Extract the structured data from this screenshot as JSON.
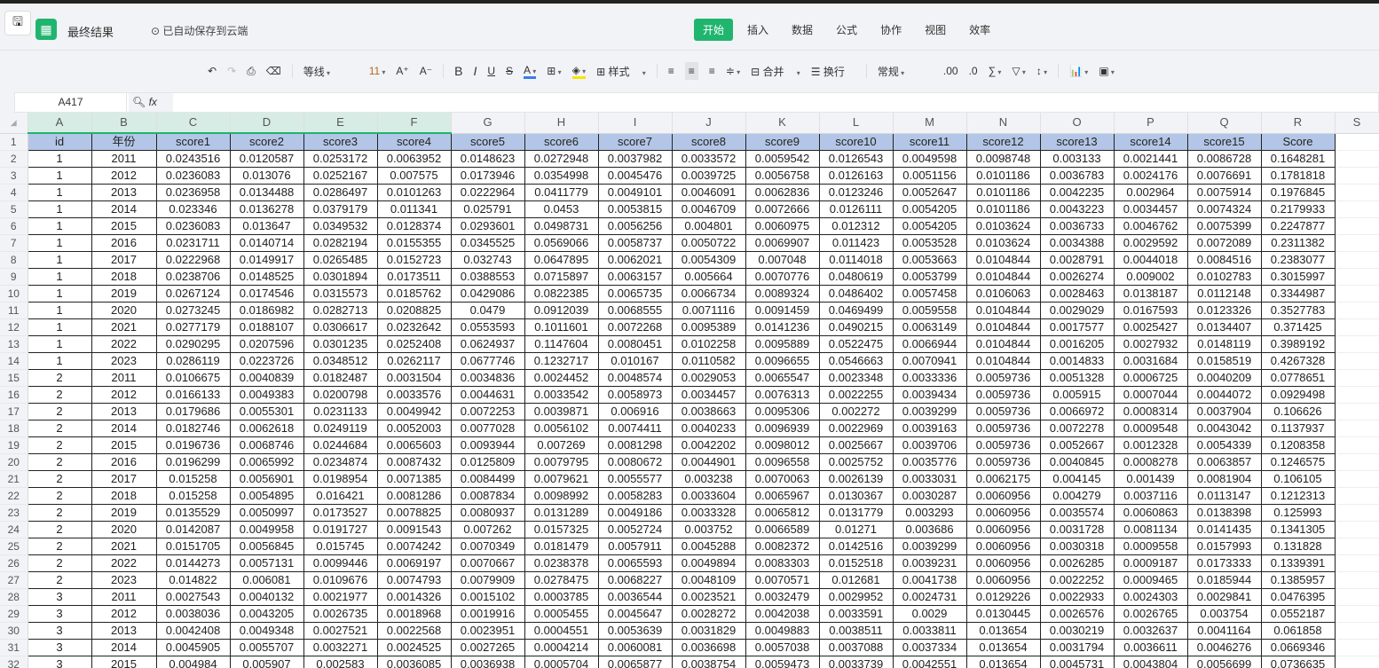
{
  "app": {
    "title": "最终结果",
    "save_status": "已自动保存到云端"
  },
  "menu": [
    "开始",
    "插入",
    "数据",
    "公式",
    "协作",
    "视图",
    "效率"
  ],
  "toolbar": {
    "font": "等线",
    "size": "11",
    "style": "样式",
    "merge": "合并",
    "wrap": "换行",
    "format": "常规"
  },
  "formula_bar": {
    "cell_ref": "A417",
    "fx": "fx",
    "value": ""
  },
  "columns": [
    "A",
    "B",
    "C",
    "D",
    "E",
    "F",
    "G",
    "H",
    "I",
    "J",
    "K",
    "L",
    "M",
    "N",
    "O",
    "P",
    "Q",
    "R",
    "S"
  ],
  "rows": [
    [
      "id",
      "年份",
      "score1",
      "score2",
      "score3",
      "score4",
      "score5",
      "score6",
      "score7",
      "score8",
      "score9",
      "score10",
      "score11",
      "score12",
      "score13",
      "score14",
      "score15",
      "Score"
    ],
    [
      "1",
      "2011",
      "0.0243516",
      "0.0120587",
      "0.0253172",
      "0.0063952",
      "0.0148623",
      "0.0272948",
      "0.0037982",
      "0.0033572",
      "0.0059542",
      "0.0126543",
      "0.0049598",
      "0.0098748",
      "0.003133",
      "0.0021441",
      "0.0086728",
      "0.1648281"
    ],
    [
      "1",
      "2012",
      "0.0236083",
      "0.013076",
      "0.0252167",
      "0.007575",
      "0.0173946",
      "0.0354998",
      "0.0045476",
      "0.0039725",
      "0.0056758",
      "0.0126163",
      "0.0051156",
      "0.0101186",
      "0.0036783",
      "0.0024176",
      "0.0076691",
      "0.1781818"
    ],
    [
      "1",
      "2013",
      "0.0236958",
      "0.0134488",
      "0.0286497",
      "0.0101263",
      "0.0222964",
      "0.0411779",
      "0.0049101",
      "0.0046091",
      "0.0062836",
      "0.0123246",
      "0.0052647",
      "0.0101186",
      "0.0042235",
      "0.002964",
      "0.0075914",
      "0.1976845"
    ],
    [
      "1",
      "2014",
      "0.023346",
      "0.0136278",
      "0.0379179",
      "0.011341",
      "0.025791",
      "0.0453",
      "0.0053815",
      "0.0046709",
      "0.0072666",
      "0.0126111",
      "0.0054205",
      "0.0101186",
      "0.0043223",
      "0.0034457",
      "0.0074324",
      "0.2179933"
    ],
    [
      "1",
      "2015",
      "0.0236083",
      "0.013647",
      "0.0349532",
      "0.0128374",
      "0.0293601",
      "0.0498731",
      "0.0056256",
      "0.004801",
      "0.0060975",
      "0.012312",
      "0.0054205",
      "0.0103624",
      "0.0036733",
      "0.0046762",
      "0.0075399",
      "0.2247877"
    ],
    [
      "1",
      "2016",
      "0.0231711",
      "0.0140714",
      "0.0282194",
      "0.0155355",
      "0.0345525",
      "0.0569066",
      "0.0058737",
      "0.0050722",
      "0.0069907",
      "0.011423",
      "0.0053528",
      "0.0103624",
      "0.0034388",
      "0.0029592",
      "0.0072089",
      "0.2311382"
    ],
    [
      "1",
      "2017",
      "0.0222968",
      "0.0149917",
      "0.0265485",
      "0.0152723",
      "0.032743",
      "0.0647895",
      "0.0062021",
      "0.0054309",
      "0.007048",
      "0.0114018",
      "0.0053663",
      "0.0104844",
      "0.0028791",
      "0.0044018",
      "0.0084516",
      "0.2383077"
    ],
    [
      "1",
      "2018",
      "0.0238706",
      "0.0148525",
      "0.0301894",
      "0.0173511",
      "0.0388553",
      "0.0715897",
      "0.0063157",
      "0.005664",
      "0.0070776",
      "0.0480619",
      "0.0053799",
      "0.0104844",
      "0.0026274",
      "0.009002",
      "0.0102783",
      "0.3015997"
    ],
    [
      "1",
      "2019",
      "0.0267124",
      "0.0174546",
      "0.0315573",
      "0.0185762",
      "0.0429086",
      "0.0822385",
      "0.0065735",
      "0.0066734",
      "0.0089324",
      "0.0486402",
      "0.0057458",
      "0.0106063",
      "0.0028463",
      "0.0138187",
      "0.0112148",
      "0.3344987"
    ],
    [
      "1",
      "2020",
      "0.0273245",
      "0.0186982",
      "0.0282713",
      "0.0208825",
      "0.0479",
      "0.0912039",
      "0.0068555",
      "0.0071116",
      "0.0091459",
      "0.0469499",
      "0.0059558",
      "0.0104844",
      "0.0029029",
      "0.0167593",
      "0.0123326",
      "0.3527783"
    ],
    [
      "1",
      "2021",
      "0.0277179",
      "0.0188107",
      "0.0306617",
      "0.0232642",
      "0.0553593",
      "0.1011601",
      "0.0072268",
      "0.0095389",
      "0.0141236",
      "0.0490215",
      "0.0063149",
      "0.0104844",
      "0.0017577",
      "0.0025427",
      "0.0134407",
      "0.371425"
    ],
    [
      "1",
      "2022",
      "0.0290295",
      "0.0207596",
      "0.0301235",
      "0.0252408",
      "0.0624937",
      "0.1147604",
      "0.0080451",
      "0.0102258",
      "0.0095889",
      "0.0522475",
      "0.0066944",
      "0.0104844",
      "0.0016205",
      "0.0027932",
      "0.0148119",
      "0.3989192"
    ],
    [
      "1",
      "2023",
      "0.0286119",
      "0.0223726",
      "0.0348512",
      "0.0262117",
      "0.0677746",
      "0.1232717",
      "0.010167",
      "0.0110582",
      "0.0096655",
      "0.0546663",
      "0.0070941",
      "0.0104844",
      "0.0014833",
      "0.0031684",
      "0.0158519",
      "0.4267328"
    ],
    [
      "2",
      "2011",
      "0.0106675",
      "0.0040839",
      "0.0182487",
      "0.0031504",
      "0.0034836",
      "0.0024452",
      "0.0048574",
      "0.0029053",
      "0.0065547",
      "0.0023348",
      "0.0033336",
      "0.0059736",
      "0.0051328",
      "0.0006725",
      "0.0040209",
      "0.0778651"
    ],
    [
      "2",
      "2012",
      "0.0166133",
      "0.0049383",
      "0.0200798",
      "0.0033576",
      "0.0044631",
      "0.0033542",
      "0.0058973",
      "0.0034457",
      "0.0076313",
      "0.0022255",
      "0.0039434",
      "0.0059736",
      "0.005915",
      "0.0007044",
      "0.0044072",
      "0.0929498"
    ],
    [
      "2",
      "2013",
      "0.0179686",
      "0.0055301",
      "0.0231133",
      "0.0049942",
      "0.0072253",
      "0.0039871",
      "0.006916",
      "0.0038663",
      "0.0095306",
      "0.002272",
      "0.0039299",
      "0.0059736",
      "0.0066972",
      "0.0008314",
      "0.0037904",
      "0.106626"
    ],
    [
      "2",
      "2014",
      "0.0182746",
      "0.0062618",
      "0.0249119",
      "0.0052003",
      "0.0077028",
      "0.0056102",
      "0.0074411",
      "0.0040233",
      "0.0096939",
      "0.0022969",
      "0.0039163",
      "0.0059736",
      "0.0072278",
      "0.0009548",
      "0.0043042",
      "0.1137937"
    ],
    [
      "2",
      "2015",
      "0.0196736",
      "0.0068746",
      "0.0244684",
      "0.0065603",
      "0.0093944",
      "0.007269",
      "0.0081298",
      "0.0042202",
      "0.0098012",
      "0.0025667",
      "0.0039706",
      "0.0059736",
      "0.0052667",
      "0.0012328",
      "0.0054339",
      "0.1208358"
    ],
    [
      "2",
      "2016",
      "0.0196299",
      "0.0065992",
      "0.0234874",
      "0.0087432",
      "0.0125809",
      "0.0079795",
      "0.0080672",
      "0.0044901",
      "0.0096558",
      "0.0025752",
      "0.0035776",
      "0.0059736",
      "0.0040845",
      "0.0008278",
      "0.0063857",
      "0.1246575"
    ],
    [
      "2",
      "2017",
      "0.015258",
      "0.0056901",
      "0.0198954",
      "0.0071385",
      "0.0084499",
      "0.0079621",
      "0.0055577",
      "0.003238",
      "0.0070063",
      "0.0026139",
      "0.0033031",
      "0.0062175",
      "0.004145",
      "0.001439",
      "0.0081904",
      "0.106105"
    ],
    [
      "2",
      "2018",
      "0.015258",
      "0.0054895",
      "0.016421",
      "0.0081286",
      "0.0087834",
      "0.0098992",
      "0.0058283",
      "0.0033604",
      "0.0065967",
      "0.0130367",
      "0.0030287",
      "0.0060956",
      "0.004279",
      "0.0037116",
      "0.0113147",
      "0.1212313"
    ],
    [
      "2",
      "2019",
      "0.0135529",
      "0.0050997",
      "0.0173527",
      "0.0078825",
      "0.0080937",
      "0.0131289",
      "0.0049186",
      "0.0033328",
      "0.0065812",
      "0.0131779",
      "0.003293",
      "0.0060956",
      "0.0035574",
      "0.0060863",
      "0.0138398",
      "0.125993"
    ],
    [
      "2",
      "2020",
      "0.0142087",
      "0.0049958",
      "0.0191727",
      "0.0091543",
      "0.007262",
      "0.0157325",
      "0.0052724",
      "0.003752",
      "0.0066589",
      "0.01271",
      "0.003686",
      "0.0060956",
      "0.0031728",
      "0.0081134",
      "0.0141435",
      "0.1341305"
    ],
    [
      "2",
      "2021",
      "0.0151705",
      "0.0056845",
      "0.015745",
      "0.0074242",
      "0.0070349",
      "0.0181479",
      "0.0057911",
      "0.0045288",
      "0.0082372",
      "0.0142516",
      "0.0039299",
      "0.0060956",
      "0.0030318",
      "0.0009558",
      "0.0157993",
      "0.131828"
    ],
    [
      "2",
      "2022",
      "0.0144273",
      "0.0057131",
      "0.0099446",
      "0.0069197",
      "0.0070667",
      "0.0238378",
      "0.0065593",
      "0.0049894",
      "0.0083303",
      "0.0152518",
      "0.0039231",
      "0.0060956",
      "0.0026285",
      "0.0009187",
      "0.0173333",
      "0.1339391"
    ],
    [
      "2",
      "2023",
      "0.014822",
      "0.006081",
      "0.0109676",
      "0.0074793",
      "0.0079909",
      "0.0278475",
      "0.0068227",
      "0.0048109",
      "0.0070571",
      "0.012681",
      "0.0041738",
      "0.0060956",
      "0.0022252",
      "0.0009465",
      "0.0185944",
      "0.1385957"
    ],
    [
      "3",
      "2011",
      "0.0027543",
      "0.0040132",
      "0.0021977",
      "0.0014326",
      "0.0015102",
      "0.0003785",
      "0.0036544",
      "0.0023521",
      "0.0032479",
      "0.0029952",
      "0.0024731",
      "0.0129226",
      "0.0022933",
      "0.0024303",
      "0.0029841",
      "0.0476395"
    ],
    [
      "3",
      "2012",
      "0.0038036",
      "0.0043205",
      "0.0026735",
      "0.0018968",
      "0.0019916",
      "0.0005455",
      "0.0045647",
      "0.0028272",
      "0.0042038",
      "0.0033591",
      "0.0029",
      "0.0130445",
      "0.0026576",
      "0.0026765",
      "0.003754",
      "0.0552187"
    ],
    [
      "3",
      "2013",
      "0.0042408",
      "0.0049348",
      "0.0027521",
      "0.0022568",
      "0.0023951",
      "0.0004551",
      "0.0053639",
      "0.0031829",
      "0.0049883",
      "0.0038511",
      "0.0033811",
      "0.013654",
      "0.0030219",
      "0.0032637",
      "0.0041164",
      "0.061858"
    ],
    [
      "3",
      "2014",
      "0.0045905",
      "0.0055707",
      "0.0032271",
      "0.0024525",
      "0.0027265",
      "0.0004214",
      "0.0060081",
      "0.0036698",
      "0.0057038",
      "0.0037088",
      "0.0037334",
      "0.013654",
      "0.0031794",
      "0.0036611",
      "0.0046276",
      "0.0669346"
    ],
    [
      "3",
      "2015",
      "0.004984",
      "0.005907",
      "0.002583",
      "0.0036085",
      "0.0036938",
      "0.0005704",
      "0.0065877",
      "0.0038754",
      "0.0059473",
      "0.0033739",
      "0.0042551",
      "0.013654",
      "0.0045731",
      "0.0043804",
      "0.0056699",
      "0.0736635"
    ]
  ]
}
